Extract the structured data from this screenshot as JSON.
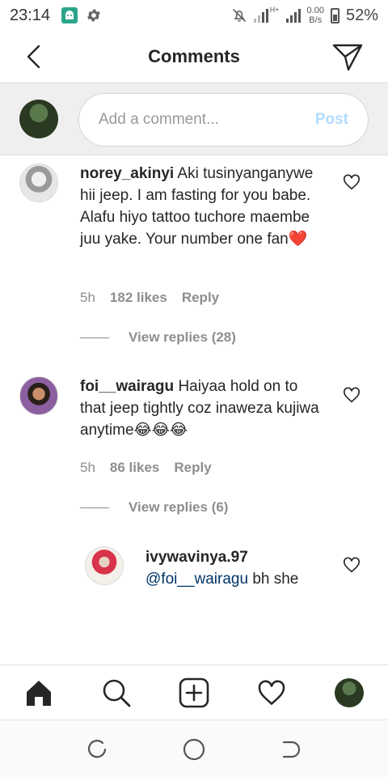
{
  "status_bar": {
    "time": "23:14",
    "network_type": "H+",
    "net_speed_value": "0.00",
    "net_speed_unit": "B/s",
    "battery": "52%"
  },
  "header": {
    "title": "Comments"
  },
  "composer": {
    "placeholder": "Add a comment...",
    "post_label": "Post"
  },
  "comments": [
    {
      "username": "norey_akinyi",
      "text": "Aki tusinyanganywe hii jeep. I am fasting for you babe. Alafu hiyo tattoo tuchore maembe juu yake. Your number one fan❤️",
      "time": "5h",
      "likes": "182 likes",
      "reply_label": "Reply",
      "view_replies": "View replies (28)"
    },
    {
      "username": "foi__wairagu",
      "text": "Haiyaa hold on to that jeep tightly coz inaweza kujiwa anytime😂😂😂",
      "time": "5h",
      "likes": "86 likes",
      "reply_label": "Reply",
      "view_replies": "View replies (6)"
    }
  ],
  "reply": {
    "username": "ivywavinya.97",
    "mention": "@foi__wairagu",
    "text": "bh she"
  },
  "bottom_nav": {
    "items": [
      "home-icon",
      "search-icon",
      "add-post-icon",
      "activity-heart-icon",
      "profile-avatar"
    ]
  },
  "colors": {
    "post_disabled": "#b3dbff",
    "mention": "#003569",
    "meta_gray": "#8e8e8e",
    "heart_red": "#e0245e"
  }
}
